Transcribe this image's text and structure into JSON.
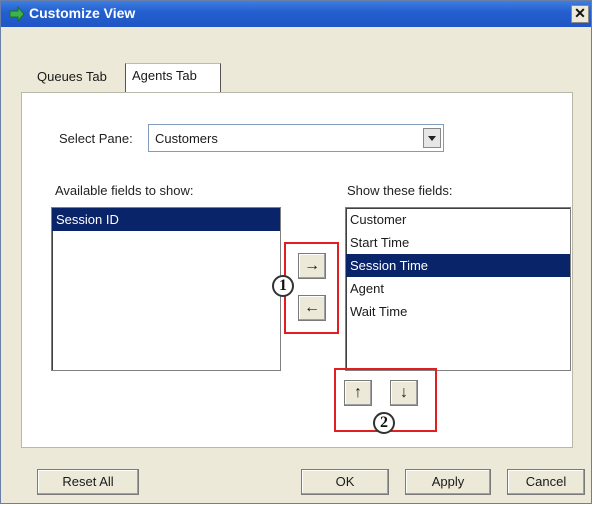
{
  "window": {
    "title": "Customize View",
    "close_glyph": "✕"
  },
  "tabs": [
    {
      "label": "Queues Tab"
    },
    {
      "label": "Agents Tab"
    }
  ],
  "select_pane": {
    "label": "Select Pane:",
    "value": "Customers"
  },
  "available": {
    "label": "Available fields to show:",
    "items": [
      "Session ID"
    ],
    "selected_index": 0
  },
  "shown": {
    "label": "Show these fields:",
    "items": [
      "Customer",
      "Start Time",
      "Session Time",
      "Agent",
      "Wait Time"
    ],
    "selected_index": 2
  },
  "move_buttons": {
    "add": "→",
    "remove": "←"
  },
  "order_buttons": {
    "up": "↑",
    "down": "↓"
  },
  "callouts": {
    "one": "1",
    "two": "2"
  },
  "footer": {
    "reset": "Reset All",
    "ok": "OK",
    "apply": "Apply",
    "cancel": "Cancel"
  },
  "colors": {
    "title_bar": "#2560d0",
    "selection": "#0a246a",
    "callout": "#e02020"
  }
}
